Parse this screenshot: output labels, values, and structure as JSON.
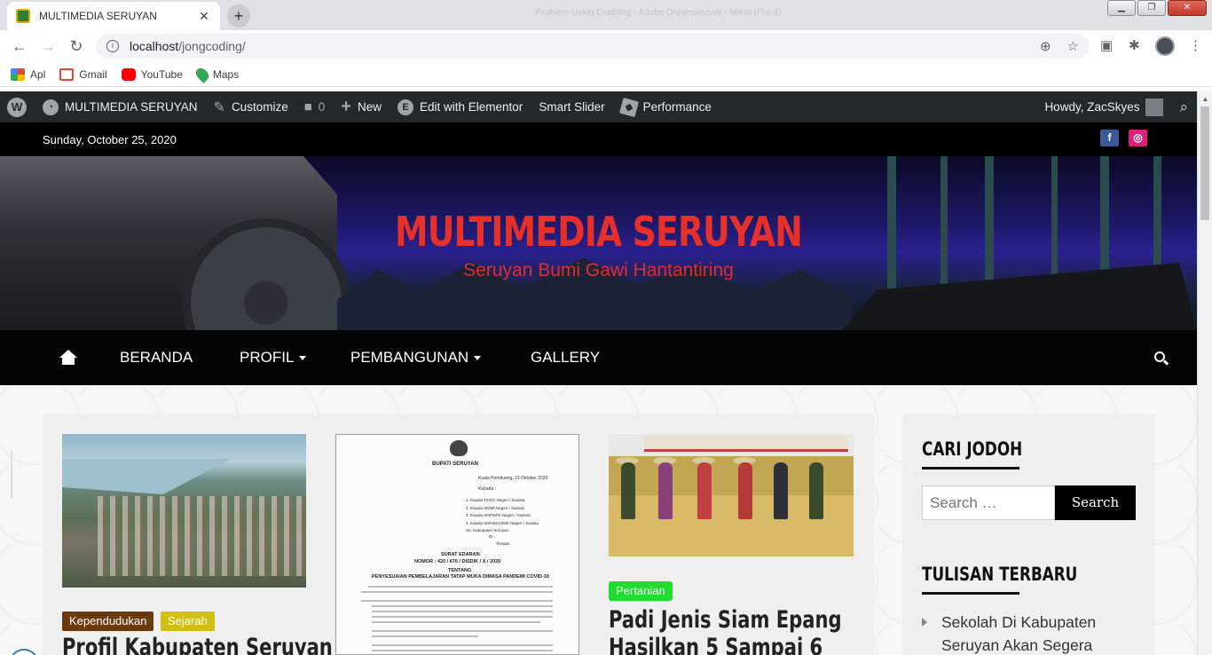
{
  "browser": {
    "tab_title": "MULTIMEDIA SERUYAN",
    "window_title": "Problem Using Enabling - Adobe Dreamweaver - Mikro (Pre 4)",
    "url_host": "localhost",
    "url_path": "/jongcoding/"
  },
  "bookmarks": [
    {
      "label": "Apl",
      "icon": "apps-grid-icon"
    },
    {
      "label": "Gmail",
      "icon": "gmail-icon"
    },
    {
      "label": "YouTube",
      "icon": "youtube-icon"
    },
    {
      "label": "Maps",
      "icon": "maps-pin-icon"
    }
  ],
  "adminbar": {
    "site_name": "MULTIMEDIA SERUYAN",
    "customize": "Customize",
    "comments_count": "0",
    "new": "New",
    "elementor": "Edit with Elementor",
    "smart_slider": "Smart Slider",
    "performance": "Performance",
    "howdy": "Howdy, ZacSkyes"
  },
  "topbar": {
    "date": "Sunday, October 25, 2020",
    "social": [
      {
        "name": "facebook-icon",
        "glyph": "f",
        "color": "#3b5998"
      },
      {
        "name": "instagram-icon",
        "glyph": "◎",
        "color": "#d6247a"
      }
    ]
  },
  "header": {
    "title": "MULTIMEDIA SERUYAN",
    "tagline": "Seruyan Bumi Gawi Hantantiring",
    "title_color": "#e8302b"
  },
  "menu": {
    "items": [
      "BERANDA",
      "PROFIL",
      "PEMBANGUNAN",
      "GALLERY"
    ]
  },
  "posts": [
    {
      "tags": [
        {
          "label": "Kependudukan",
          "color": "#6b3a0f"
        },
        {
          "label": "Sejarah",
          "color": "#d2c012"
        }
      ],
      "title": "Profil Kabupaten Seruyan"
    },
    {
      "document": {
        "heading": "BUPATI SERUYAN",
        "date_line": "Kuala Pembuang, 21 Oktober 2020",
        "kepada": "Kepada :",
        "yth": [
          "1. Kepala TK/RA Negeri / Swasta",
          "2. Kepala SD/MI Negeri / Swasta",
          "3. Kepala SMP/MTs Negeri / Swasta",
          "4. Kepala SMA/MA/SMK Negeri / Swasta",
          "Se- Kabupaten Seruyan"
        ],
        "di": "Di -",
        "tempat": "Tempat",
        "surat": "SURAT EDARAN",
        "nomor": "NOMOR : 420 / 676 / DISDIK / X / 2020",
        "tentang": "TENTANG",
        "perihal": "PENYESUAIAN PEMBELAJARAN TATAP MUKA DIMASA PANDEMI COVID-19"
      }
    },
    {
      "tags": [
        {
          "label": "Pertanian",
          "color": "#1fdc2f"
        }
      ],
      "title": "Padi Jenis Siam Epang",
      "title_line2": "Hasilkan 5 Sampai 6"
    }
  ],
  "sidebar": {
    "search_title": "CARI JODOH",
    "search_placeholder": "Search …",
    "search_button": "Search",
    "recent_title": "TULISAN TERBARU",
    "recent_items": [
      "Sekolah Di Kabupaten Seruyan Akan Segera"
    ]
  }
}
